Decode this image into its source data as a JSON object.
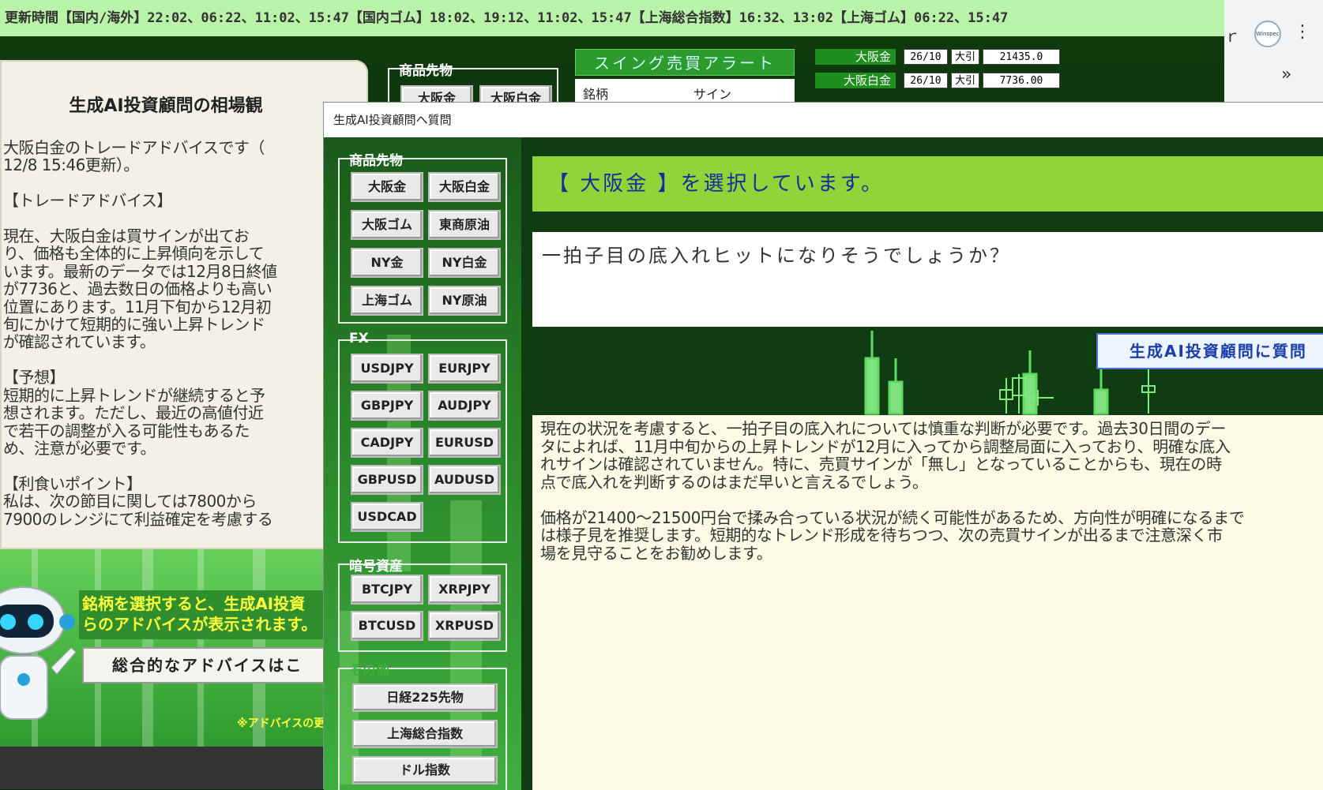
{
  "ticker": {
    "text": "更新時間【国内/海外】22:02、06:22、11:02、15:47【国内ゴム】18:02、19:12、11:02、15:47【上海総合指数】16:32、13:02【上海ゴム】06:22、15:47"
  },
  "browser": {
    "extension_label": "Winspec",
    "menu_glyph": "⋮",
    "more_glyph": "»"
  },
  "left_panel": {
    "title": "生成AI投資顧問の相場観",
    "text": "大阪白金のトレードアドバイスです（\n12/8 15:46更新）。\n\n【トレードアドバイス】\n\n現在、大阪白金は買サインが出てお\nり、価格も全体的に上昇傾向を示して\nいます。最新のデータでは12月8日終値\nが7736と、過去数日の価格よりも高い\n位置にあります。11月下旬から12月初\n旬にかけて短期的に強い上昇トレンド\nが確認されています。\n\n【予想】\n短期的に上昇トレンドが継続すると予\n想されます。ただし、最近の高値付近\nで若干の調整が入る可能性もあるた\nめ、注意が必要です。\n\n【利食いポイント】\n私は、次の節目に関しては7800から\n7900のレンジにて利益確定を考慮する"
  },
  "left_banner": {
    "yellow_text": "銘柄を選択すると、生成AI投資\nらのアドバイスが表示されます。",
    "button_label": "総合的なアドバイスはこ",
    "note": "※アドバイスの更"
  },
  "back_window": {
    "commodities_legend": "商品先物",
    "buttons": [
      "大阪金",
      "大阪白金"
    ],
    "swing_title": "スイング売買アラート",
    "swing_headers": [
      "銘柄",
      "サイン"
    ],
    "prices": [
      {
        "name": "大阪金",
        "date": "26/10",
        "type": "大引",
        "value": "21435.0"
      },
      {
        "name": "大阪白金",
        "date": "26/10",
        "type": "大引",
        "value": "7736.00"
      }
    ]
  },
  "dialog": {
    "title": "生成AI投資顧問へ質問",
    "groups": {
      "commodities": {
        "legend": "商品先物",
        "buttons": [
          "大阪金",
          "大阪白金",
          "大阪ゴム",
          "東商原油",
          "NY金",
          "NY白金",
          "上海ゴム",
          "NY原油"
        ]
      },
      "fx": {
        "legend": "FX",
        "buttons": [
          "USDJPY",
          "EURJPY",
          "GBPJPY",
          "AUDJPY",
          "CADJPY",
          "EURUSD",
          "GBPUSD",
          "AUDUSD",
          "USDCAD"
        ]
      },
      "crypto": {
        "legend": "暗号資産",
        "buttons": [
          "BTCJPY",
          "XRPJPY",
          "BTCUSD",
          "XRPUSD"
        ]
      },
      "other": {
        "legend": "その他",
        "buttons": [
          "日経225先物",
          "上海総合指数",
          "ドル指数"
        ]
      }
    },
    "selected_text": "【 大阪金 】を選択しています。",
    "question": "一拍子目の底入れヒットになりそうでしょうか？",
    "ask_button": "生成AI投資顧問に質問",
    "answer": "現在の状況を考慮すると、一拍子目の底入れについては慎重な判断が必要です。過去30日間のデー\nタによれば、11月中旬からの上昇トレンドが12月に入ってから調整局面に入っており、明確な底入\nれサインは確認されていません。特に、売買サインが「無し」となっていることからも、現在の時\n点で底入れを判断するのはまだ早いと言えるでしょう。\n\n価格が21400～21500円台で揉み合っている状況が続く可能性があるため、方向性が明確になるまで\nは様子見を推奨します。短期的なトレンド形成を待ちつつ、次の売買サインが出るまで注意深く市\n場を見守ることをお勧めします。"
  }
}
